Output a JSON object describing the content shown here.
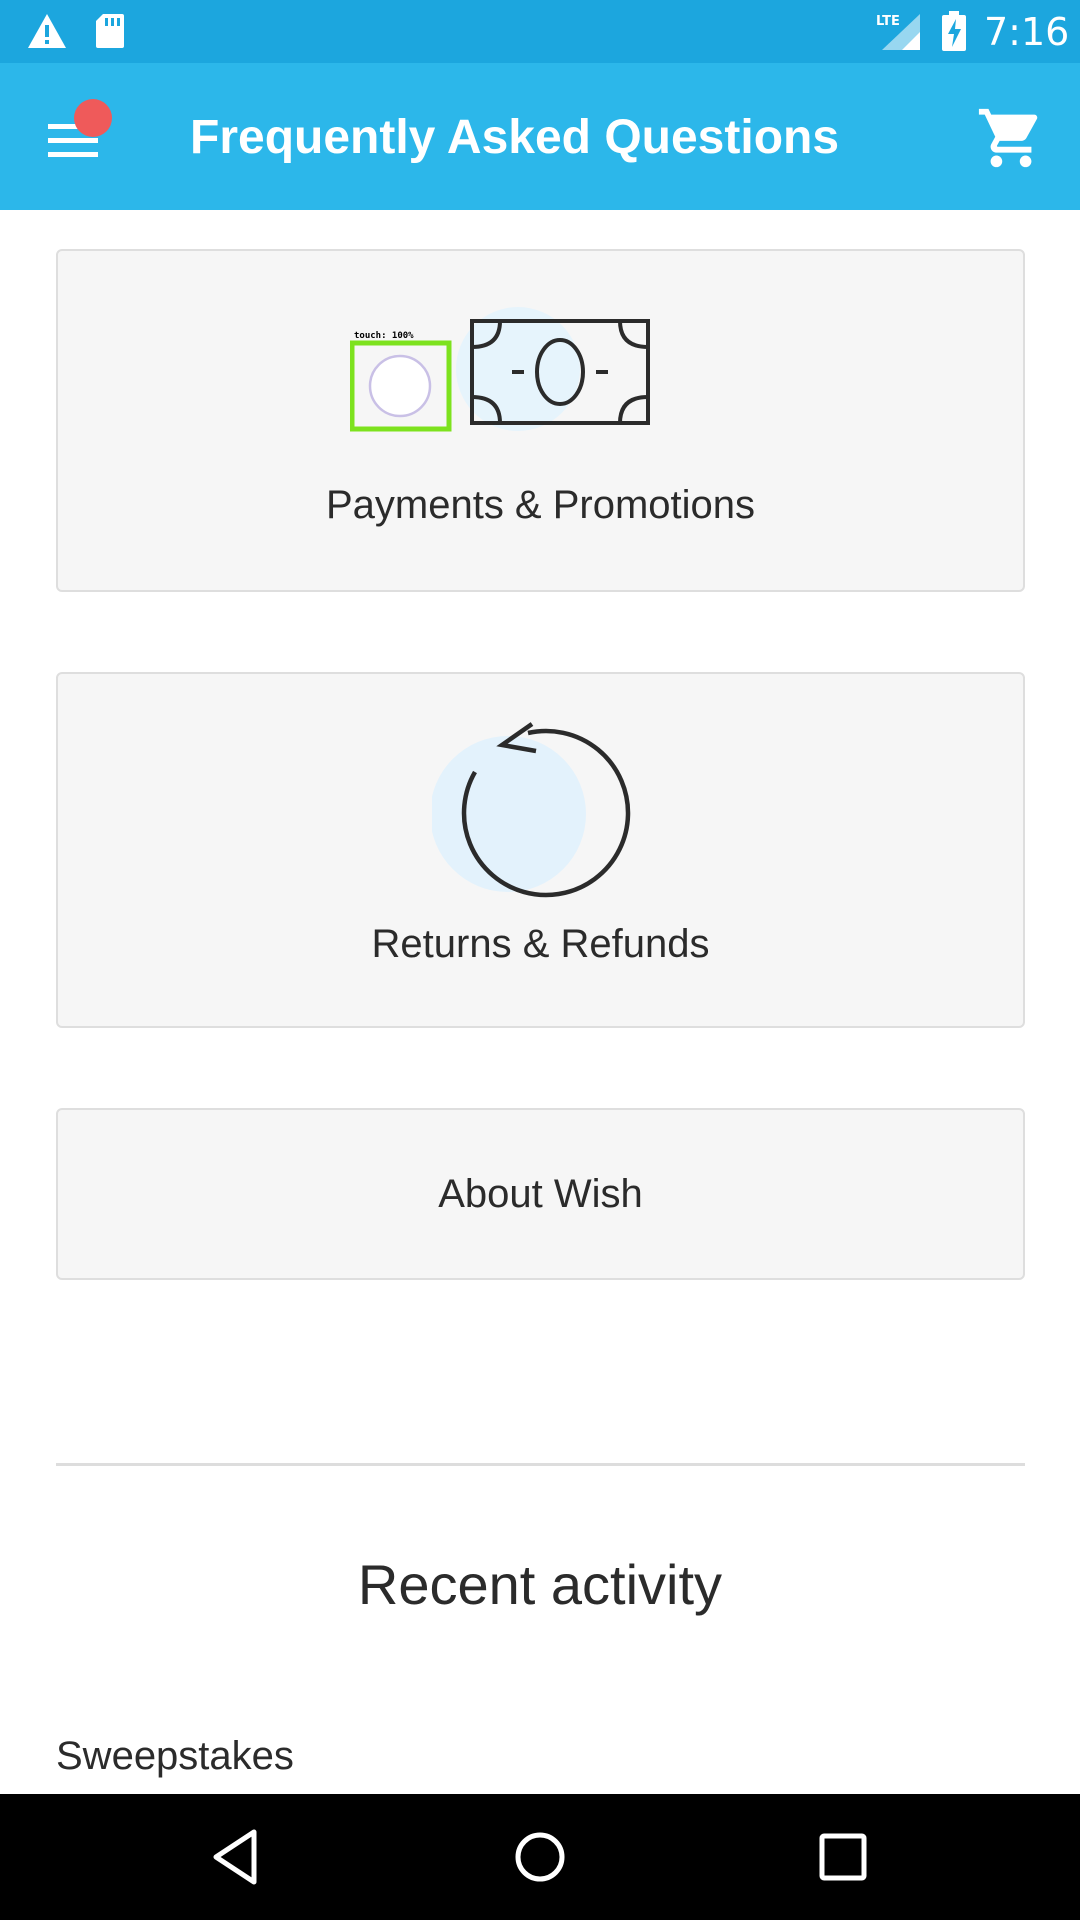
{
  "status_bar": {
    "time": "7:16",
    "icons": [
      "alert-icon",
      "sd-card-icon",
      "lte-signal-icon",
      "battery-charging-icon"
    ]
  },
  "app_bar": {
    "title": "Frequently Asked Questions",
    "icons": [
      "menu-icon",
      "cart-icon"
    ],
    "notification_color": "#ef5a5a",
    "background_color": "#2cb7ea"
  },
  "cards": [
    {
      "label": "Payments & Promotions",
      "icon": "cash-icon"
    },
    {
      "label": "Returns & Refunds",
      "icon": "refresh-icon"
    },
    {
      "label": "About Wish"
    }
  ],
  "touch_marker": {
    "text": "touch: 100%",
    "color": "#7de21e"
  },
  "recent_activity": {
    "title": "Recent activity",
    "items": [
      "Sweepstakes"
    ]
  },
  "nav_bar": {
    "icons": [
      "back-icon",
      "home-icon",
      "recents-icon"
    ]
  }
}
